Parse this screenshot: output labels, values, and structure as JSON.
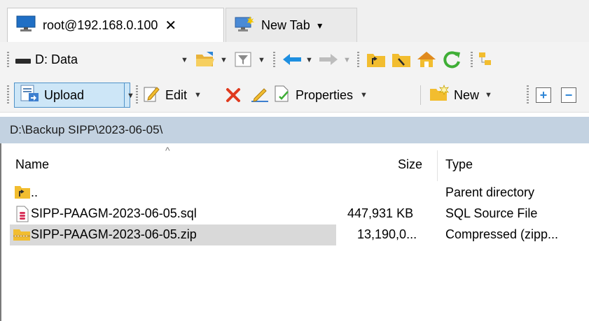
{
  "tabs": [
    {
      "label": "root@192.168.0.100",
      "close": "✕",
      "icon": "monitor-icon",
      "active": true
    },
    {
      "label": "New Tab",
      "dropdown": "▼",
      "icon": "new-tab-monitor-icon",
      "active": false
    }
  ],
  "toolbar1": {
    "drive_label": "D: Data",
    "dropdown_arrow": "▼"
  },
  "toolbar2": {
    "upload_label": "Upload",
    "edit_label": "Edit",
    "properties_label": "Properties",
    "new_label": "New",
    "plus_glyph": "+",
    "minus_glyph": "−",
    "dropdown_arrow": "▼"
  },
  "path": "D:\\Backup SIPP\\2023-06-05\\",
  "columns": {
    "name": "Name",
    "size": "Size",
    "type": "Type",
    "sort_indicator": "^"
  },
  "files": [
    {
      "name": "..",
      "size": "",
      "type": "Parent directory",
      "icon": "parent-folder-icon"
    },
    {
      "name": "SIPP-PAAGM-2023-06-05.sql",
      "size": "447,931 KB",
      "type": "SQL Source File",
      "icon": "sql-file-icon"
    },
    {
      "name": "SIPP-PAAGM-2023-06-05.zip",
      "size": "13,190,0...",
      "type": "Compressed (zipp...",
      "icon": "zip-folder-icon",
      "selected": true
    }
  ],
  "colors": {
    "path_bar": "#c3d2e1",
    "selection": "#d9d9d9",
    "upload_highlight": "#cde6f7",
    "delete_red": "#e03a1e",
    "nav_blue": "#1e8fe0"
  }
}
